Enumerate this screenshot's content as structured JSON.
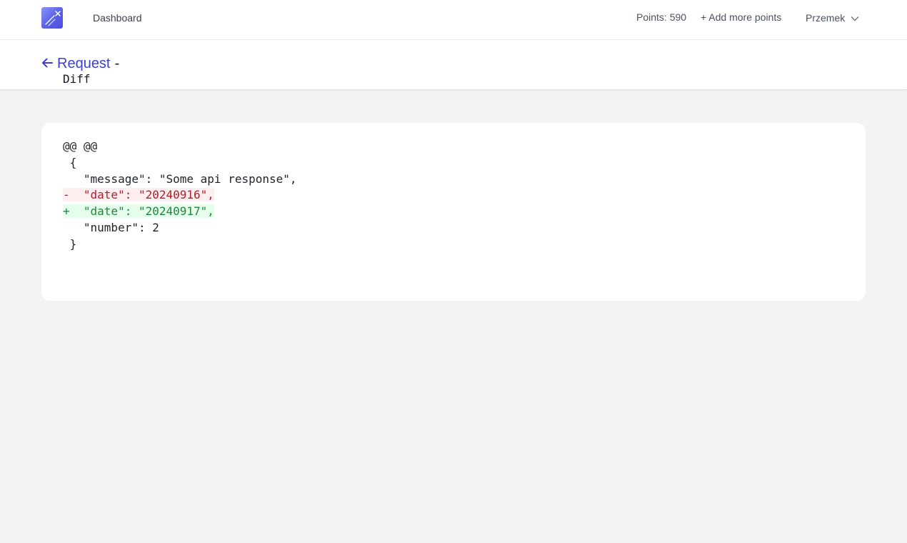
{
  "nav": {
    "logo_icon": "mask-logo-icon",
    "dashboard_label": "Dashboard",
    "points_label": "Points: 590",
    "add_points_label": "+ Add more points",
    "user_name": "Przemek",
    "user_menu_icon": "chevron-down-icon"
  },
  "header": {
    "back_icon": "arrow-left-icon",
    "back_label": "Request",
    "separator": "-",
    "title": "Diff"
  },
  "diff": {
    "lines": [
      {
        "type": "context",
        "text": "@@ @@"
      },
      {
        "type": "context",
        "text": " {"
      },
      {
        "type": "context",
        "text": "   \"message\": \"Some api response\","
      },
      {
        "type": "removed",
        "text": "-  \"date\": \"20240916\","
      },
      {
        "type": "added",
        "text": "+  \"date\": \"20240917\","
      },
      {
        "type": "context",
        "text": "   \"number\": 2"
      },
      {
        "type": "context",
        "text": " }"
      }
    ]
  },
  "colors": {
    "accent": "#3b3fd8",
    "removed_text": "#b31d28",
    "removed_bg": "#ffeef0",
    "added_text": "#22863a",
    "added_bg": "#e6ffed",
    "page_bg": "#f3f3f3"
  }
}
